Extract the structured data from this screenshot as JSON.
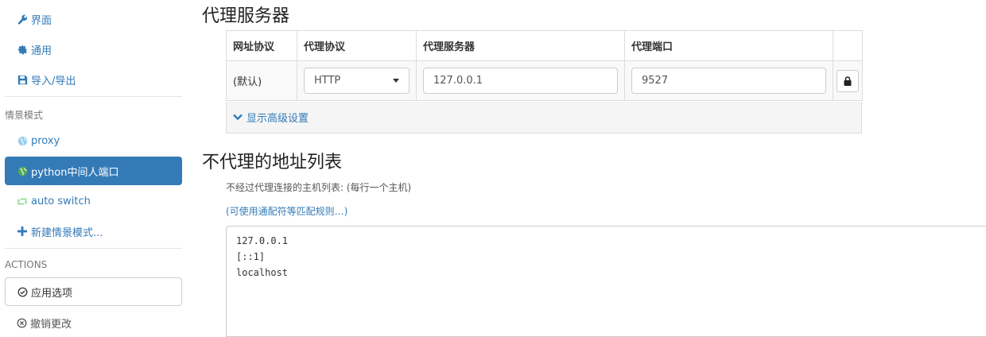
{
  "sidebar": {
    "settings_items": [
      {
        "label": "界面",
        "icon": "wrench-icon"
      },
      {
        "label": "通用",
        "icon": "gear-icon"
      },
      {
        "label": "导入/导出",
        "icon": "floppy-disk-icon"
      }
    ],
    "profiles_header": "情景模式",
    "profiles": [
      {
        "label": "proxy",
        "icon": "globe-icon",
        "color": "#99ccee"
      },
      {
        "label": "python中间人端口",
        "icon": "globe-icon",
        "color": "#55aa55",
        "active": true
      },
      {
        "label": "auto switch",
        "icon": "retweet-icon",
        "color": "#99dd99"
      },
      {
        "label": "新建情景模式...",
        "icon": "plus-icon"
      }
    ],
    "actions_header": "ACTIONS",
    "apply_label": "应用选项",
    "discard_label": "撤销更改"
  },
  "proxy_servers": {
    "title": "代理服务器",
    "columns": [
      "网址协议",
      "代理协议",
      "代理服务器",
      "代理端口"
    ],
    "row": {
      "scheme": "(默认)",
      "protocol": "HTTP",
      "server": "127.0.0.1",
      "port": "9527"
    },
    "advanced_label": "显示高级设置"
  },
  "bypass": {
    "title": "不代理的地址列表",
    "help": "不经过代理连接的主机列表: (每行一个主机)",
    "link": "(可使用通配符等匹配规则…)",
    "list": "127.0.0.1\n[::1]\nlocalhost"
  },
  "colors": {
    "accent": "#337ab7",
    "active_bg": "#337ab7"
  }
}
